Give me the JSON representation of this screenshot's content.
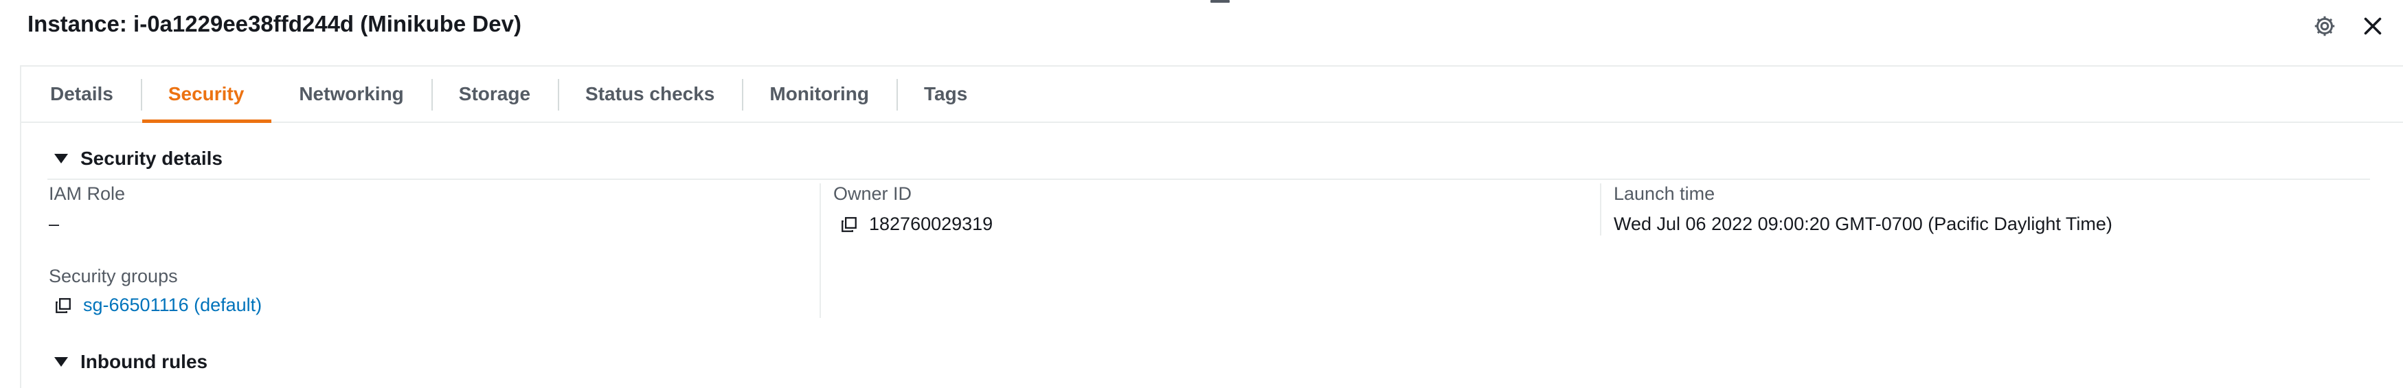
{
  "header": {
    "title": "Instance: i-0a1229ee38ffd244d (Minikube Dev)"
  },
  "tabs": [
    {
      "label": "Details",
      "active": false
    },
    {
      "label": "Security",
      "active": true
    },
    {
      "label": "Networking",
      "active": false
    },
    {
      "label": "Storage",
      "active": false
    },
    {
      "label": "Status checks",
      "active": false
    },
    {
      "label": "Monitoring",
      "active": false
    },
    {
      "label": "Tags",
      "active": false
    }
  ],
  "security_details": {
    "heading": "Security details",
    "iam_role": {
      "label": "IAM Role",
      "value": "–"
    },
    "owner_id": {
      "label": "Owner ID",
      "value": "182760029319"
    },
    "launch_time": {
      "label": "Launch time",
      "value": "Wed Jul 06 2022 09:00:20 GMT-0700 (Pacific Daylight Time)"
    },
    "security_groups": {
      "label": "Security groups",
      "value": "sg-66501116 (default)"
    }
  },
  "inbound_rules": {
    "heading": "Inbound rules"
  },
  "colors": {
    "accent": "#ec7211",
    "link": "#0073bb",
    "text": "#16191f",
    "muted": "#545b64",
    "border": "#eaeded"
  },
  "icons": {
    "settings": "gear-icon",
    "close": "close-icon",
    "copy": "copy-icon",
    "expand": "caret-down-icon"
  }
}
